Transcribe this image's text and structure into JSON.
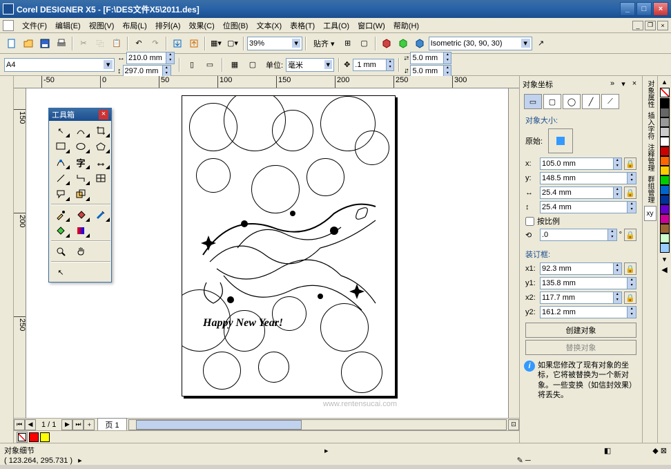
{
  "app_title": "Corel DESIGNER X5 - [F:\\DES文件X5\\2011.des]",
  "menus": [
    "文件(F)",
    "编辑(E)",
    "视图(V)",
    "布局(L)",
    "排列(A)",
    "效果(C)",
    "位图(B)",
    "文本(X)",
    "表格(T)",
    "工具(O)",
    "窗口(W)",
    "帮助(H)"
  ],
  "toolbar": {
    "zoom_value": "39%",
    "snap_label": "贴齐 ▾",
    "projection": "Isometric (30, 90, 30)"
  },
  "propbar": {
    "paper": "A4",
    "width": "210.0 mm",
    "height": "297.0 mm",
    "units_label": "单位:",
    "units": "毫米",
    "nudge": ".1 mm",
    "dup_x": "5.0 mm",
    "dup_y": "5.0 mm"
  },
  "ruler_h": [
    "-50",
    "0",
    "50",
    "100",
    "150",
    "200",
    "250",
    "300"
  ],
  "ruler_v": [
    "150",
    "200",
    "250"
  ],
  "toolbox_title": "工具箱",
  "page_text": "Happy New Year!",
  "watermark": "www.rentensucai.com",
  "page_nav": {
    "count": "1 / 1",
    "tab": "页 1"
  },
  "status": {
    "line1": "对象细节",
    "coords": "( 123.264, 295.731 )"
  },
  "docker": {
    "title": "对象坐标",
    "size_label": "对象大小:",
    "origin_label": "原始:",
    "x": "105.0 mm",
    "y": "148.5 mm",
    "w": "25.4 mm",
    "h": "25.4 mm",
    "scale_chk": "按比例",
    "rotation": ".0",
    "bbox_label": "装订框:",
    "x1": "92.3 mm",
    "y1": "135.8 mm",
    "x2": "117.7 mm",
    "y2": "161.2 mm",
    "create_btn": "创建对象",
    "replace_btn": "替换对象",
    "info": "如果您修改了现有对象的坐标，它将被替换为一个新对象。一些变换（如信封效果）将丢失。"
  },
  "right_tabs": [
    "对象属性",
    "插入字符",
    "注释管理",
    "群组管理"
  ],
  "xy_tab": "xy",
  "colors": [
    "#000000",
    "#666666",
    "#999999",
    "#cccccc",
    "#ffffff",
    "#cc0000",
    "#ff6600",
    "#ffcc00",
    "#00cc00",
    "#0066cc",
    "#003399",
    "#6600cc",
    "#cc0099",
    "#996633",
    "#ccffcc",
    "#99ccff"
  ]
}
